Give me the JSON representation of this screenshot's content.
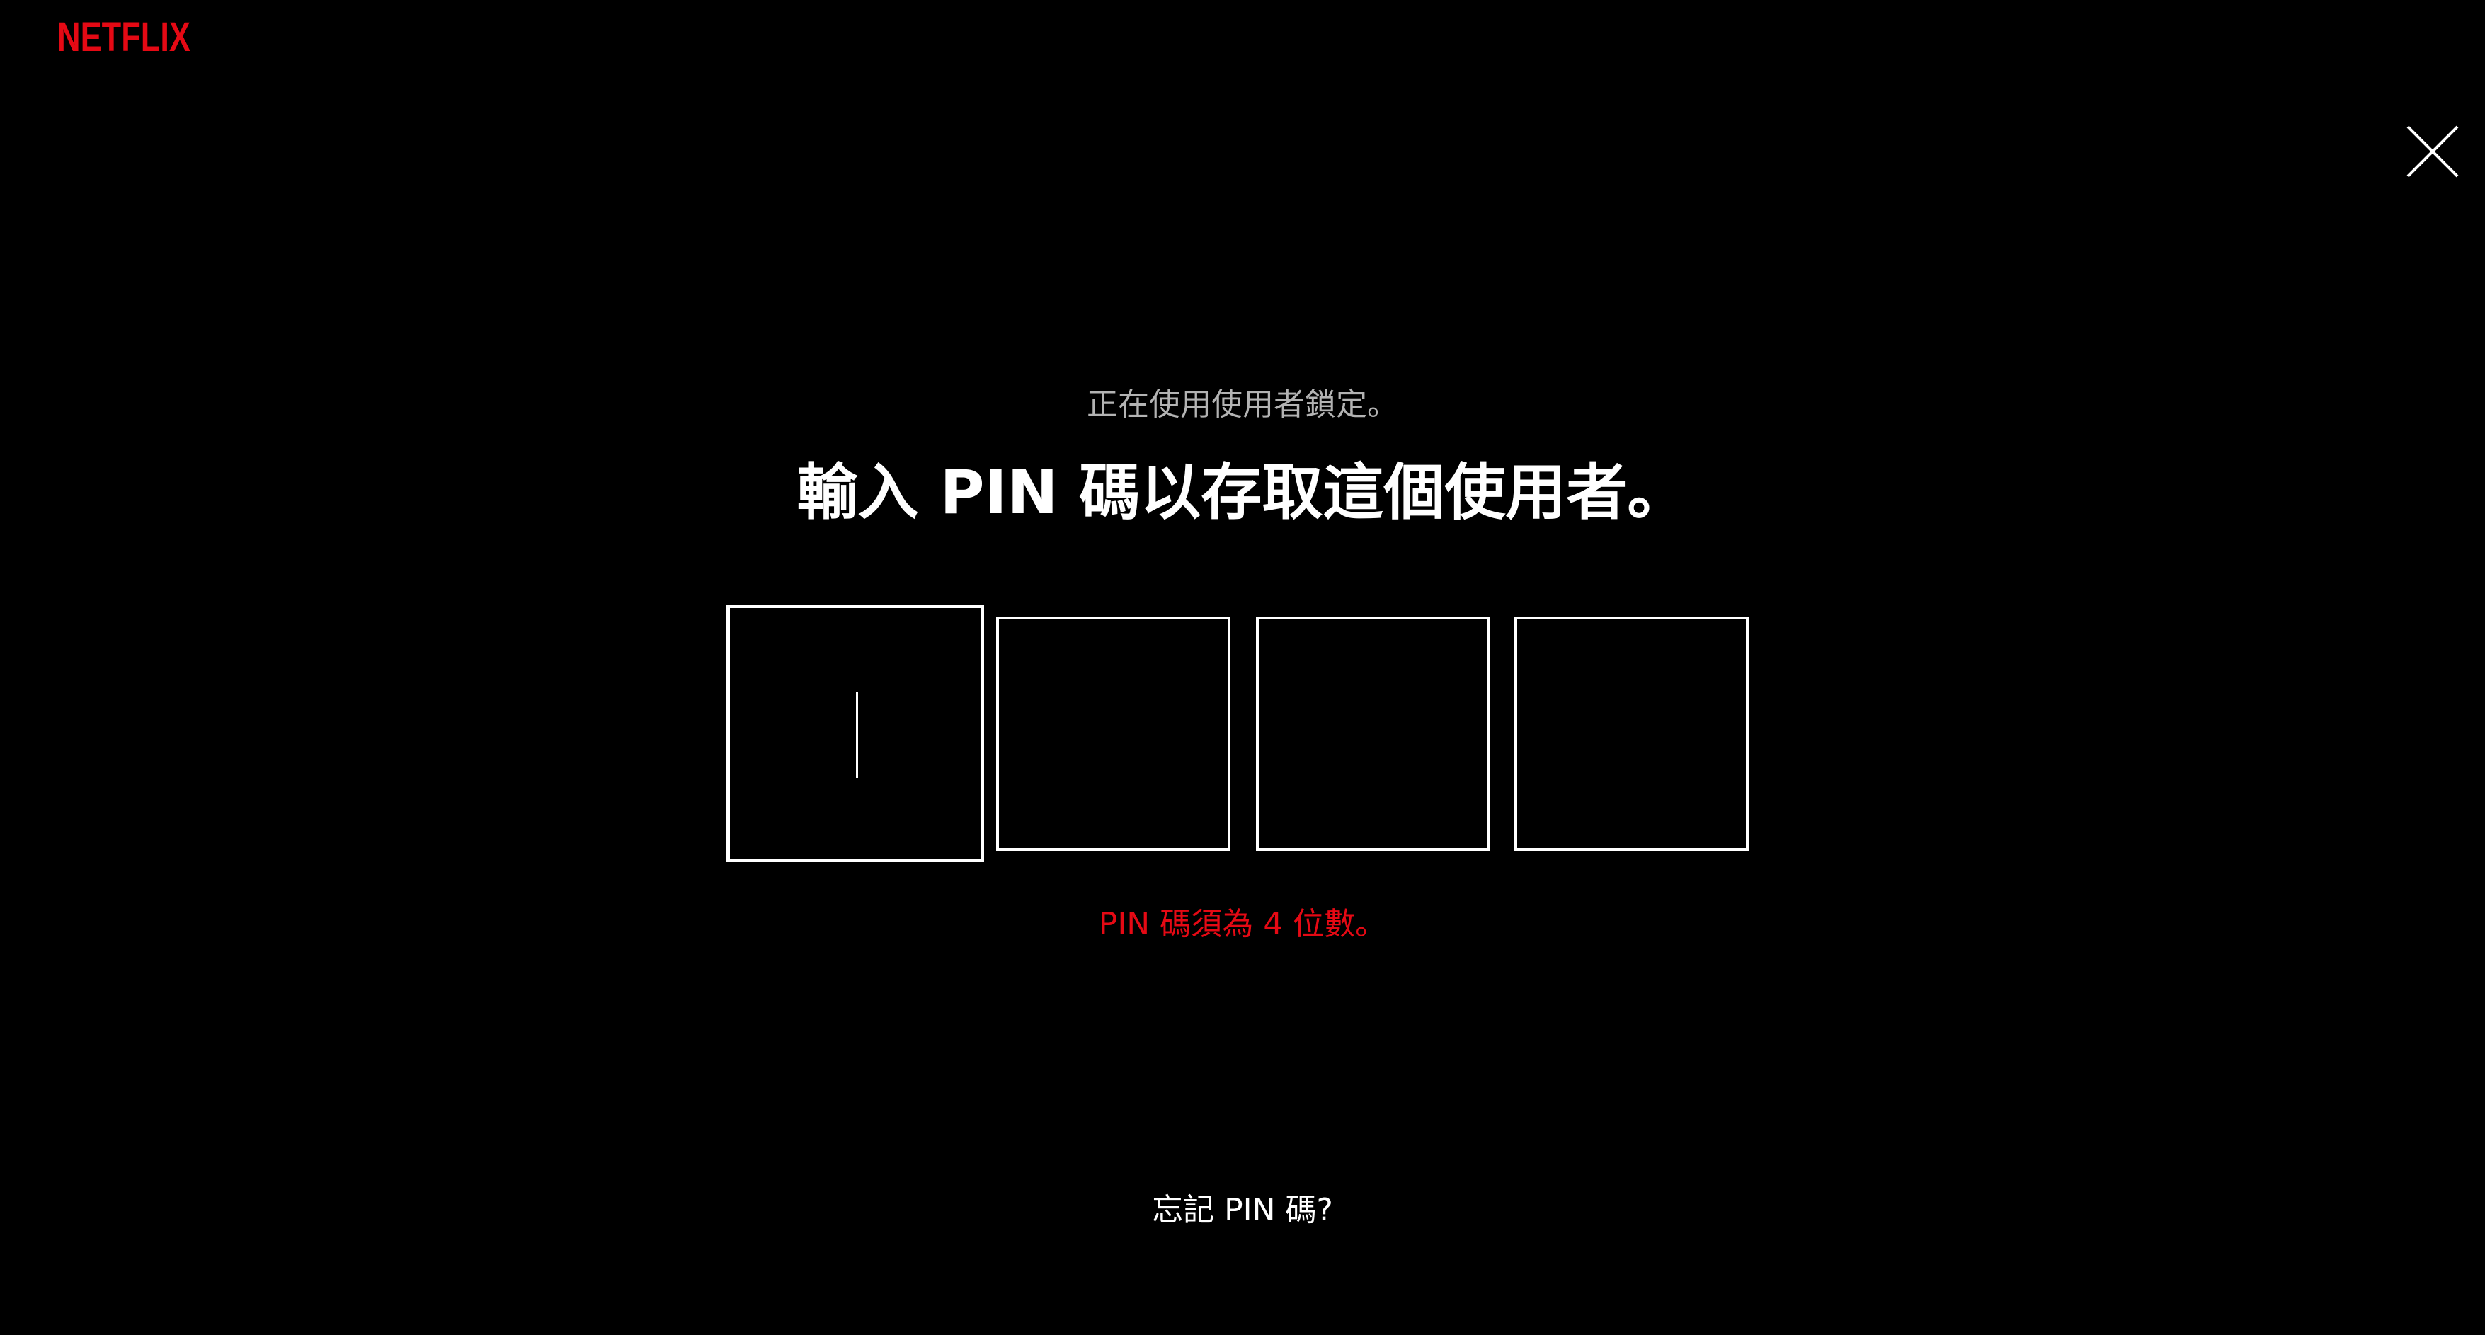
{
  "brand": {
    "logo_text": "NETFLIX",
    "logo_color": "#e50914"
  },
  "close": {
    "icon": "close-icon"
  },
  "prompt": {
    "subtitle": "正在使用使用者鎖定。",
    "title": "輸入 PIN 碼以存取這個使用者。"
  },
  "pin": {
    "digits": [
      "",
      "",
      "",
      ""
    ],
    "active_index": 0
  },
  "error": {
    "message": "PIN 碼須為 4 位數。",
    "color": "#e50914"
  },
  "forgot": {
    "label": "忘記 PIN 碼?"
  }
}
